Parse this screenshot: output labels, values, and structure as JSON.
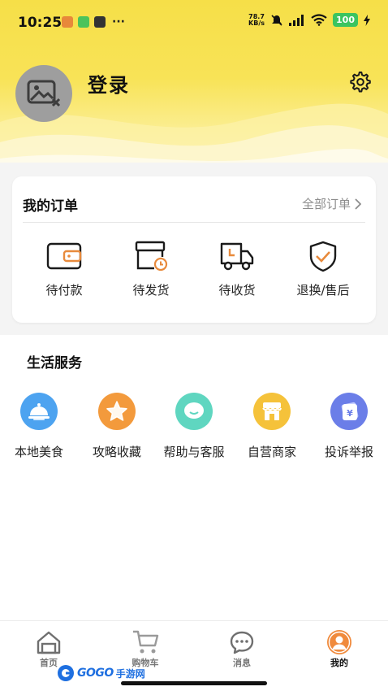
{
  "status_bar": {
    "time": "10:25",
    "dots": "···",
    "net_speed_value": "78.7",
    "net_speed_unit": "KB/s",
    "battery": "100"
  },
  "profile": {
    "login_label": "登录"
  },
  "orders": {
    "title": "我的订单",
    "view_all": "全部订单",
    "items": [
      {
        "label": "待付款",
        "icon": "wallet-icon"
      },
      {
        "label": "待发货",
        "icon": "package-clock-icon"
      },
      {
        "label": "待收货",
        "icon": "truck-icon"
      },
      {
        "label": "退换/售后",
        "icon": "shield-check-icon"
      }
    ]
  },
  "services": {
    "title": "生活服务",
    "items": [
      {
        "label": "本地美食",
        "icon": "food-cloche-icon",
        "color": "#4da3f0"
      },
      {
        "label": "攻略收藏",
        "icon": "star-icon",
        "color": "#f39a3c"
      },
      {
        "label": "帮助与客服",
        "icon": "chat-bubble-icon",
        "color": "#5fd6c0"
      },
      {
        "label": "自营商家",
        "icon": "store-icon",
        "color": "#f5c23a"
      },
      {
        "label": "投诉举报",
        "icon": "yuan-card-icon",
        "color": "#6b7ee8"
      }
    ]
  },
  "tabbar": {
    "items": [
      {
        "label": "首页",
        "icon": "home-icon",
        "active": false
      },
      {
        "label": "购物车",
        "icon": "cart-icon",
        "active": false
      },
      {
        "label": "消息",
        "icon": "message-icon",
        "active": false
      },
      {
        "label": "我的",
        "icon": "user-icon",
        "active": true
      }
    ]
  },
  "watermark": {
    "brand": "GOGO",
    "suffix": "手游网"
  },
  "colors": {
    "header_yellow": "#f6df48",
    "accent_orange": "#e88a3c",
    "active_tab_orange": "#f08a3c"
  }
}
